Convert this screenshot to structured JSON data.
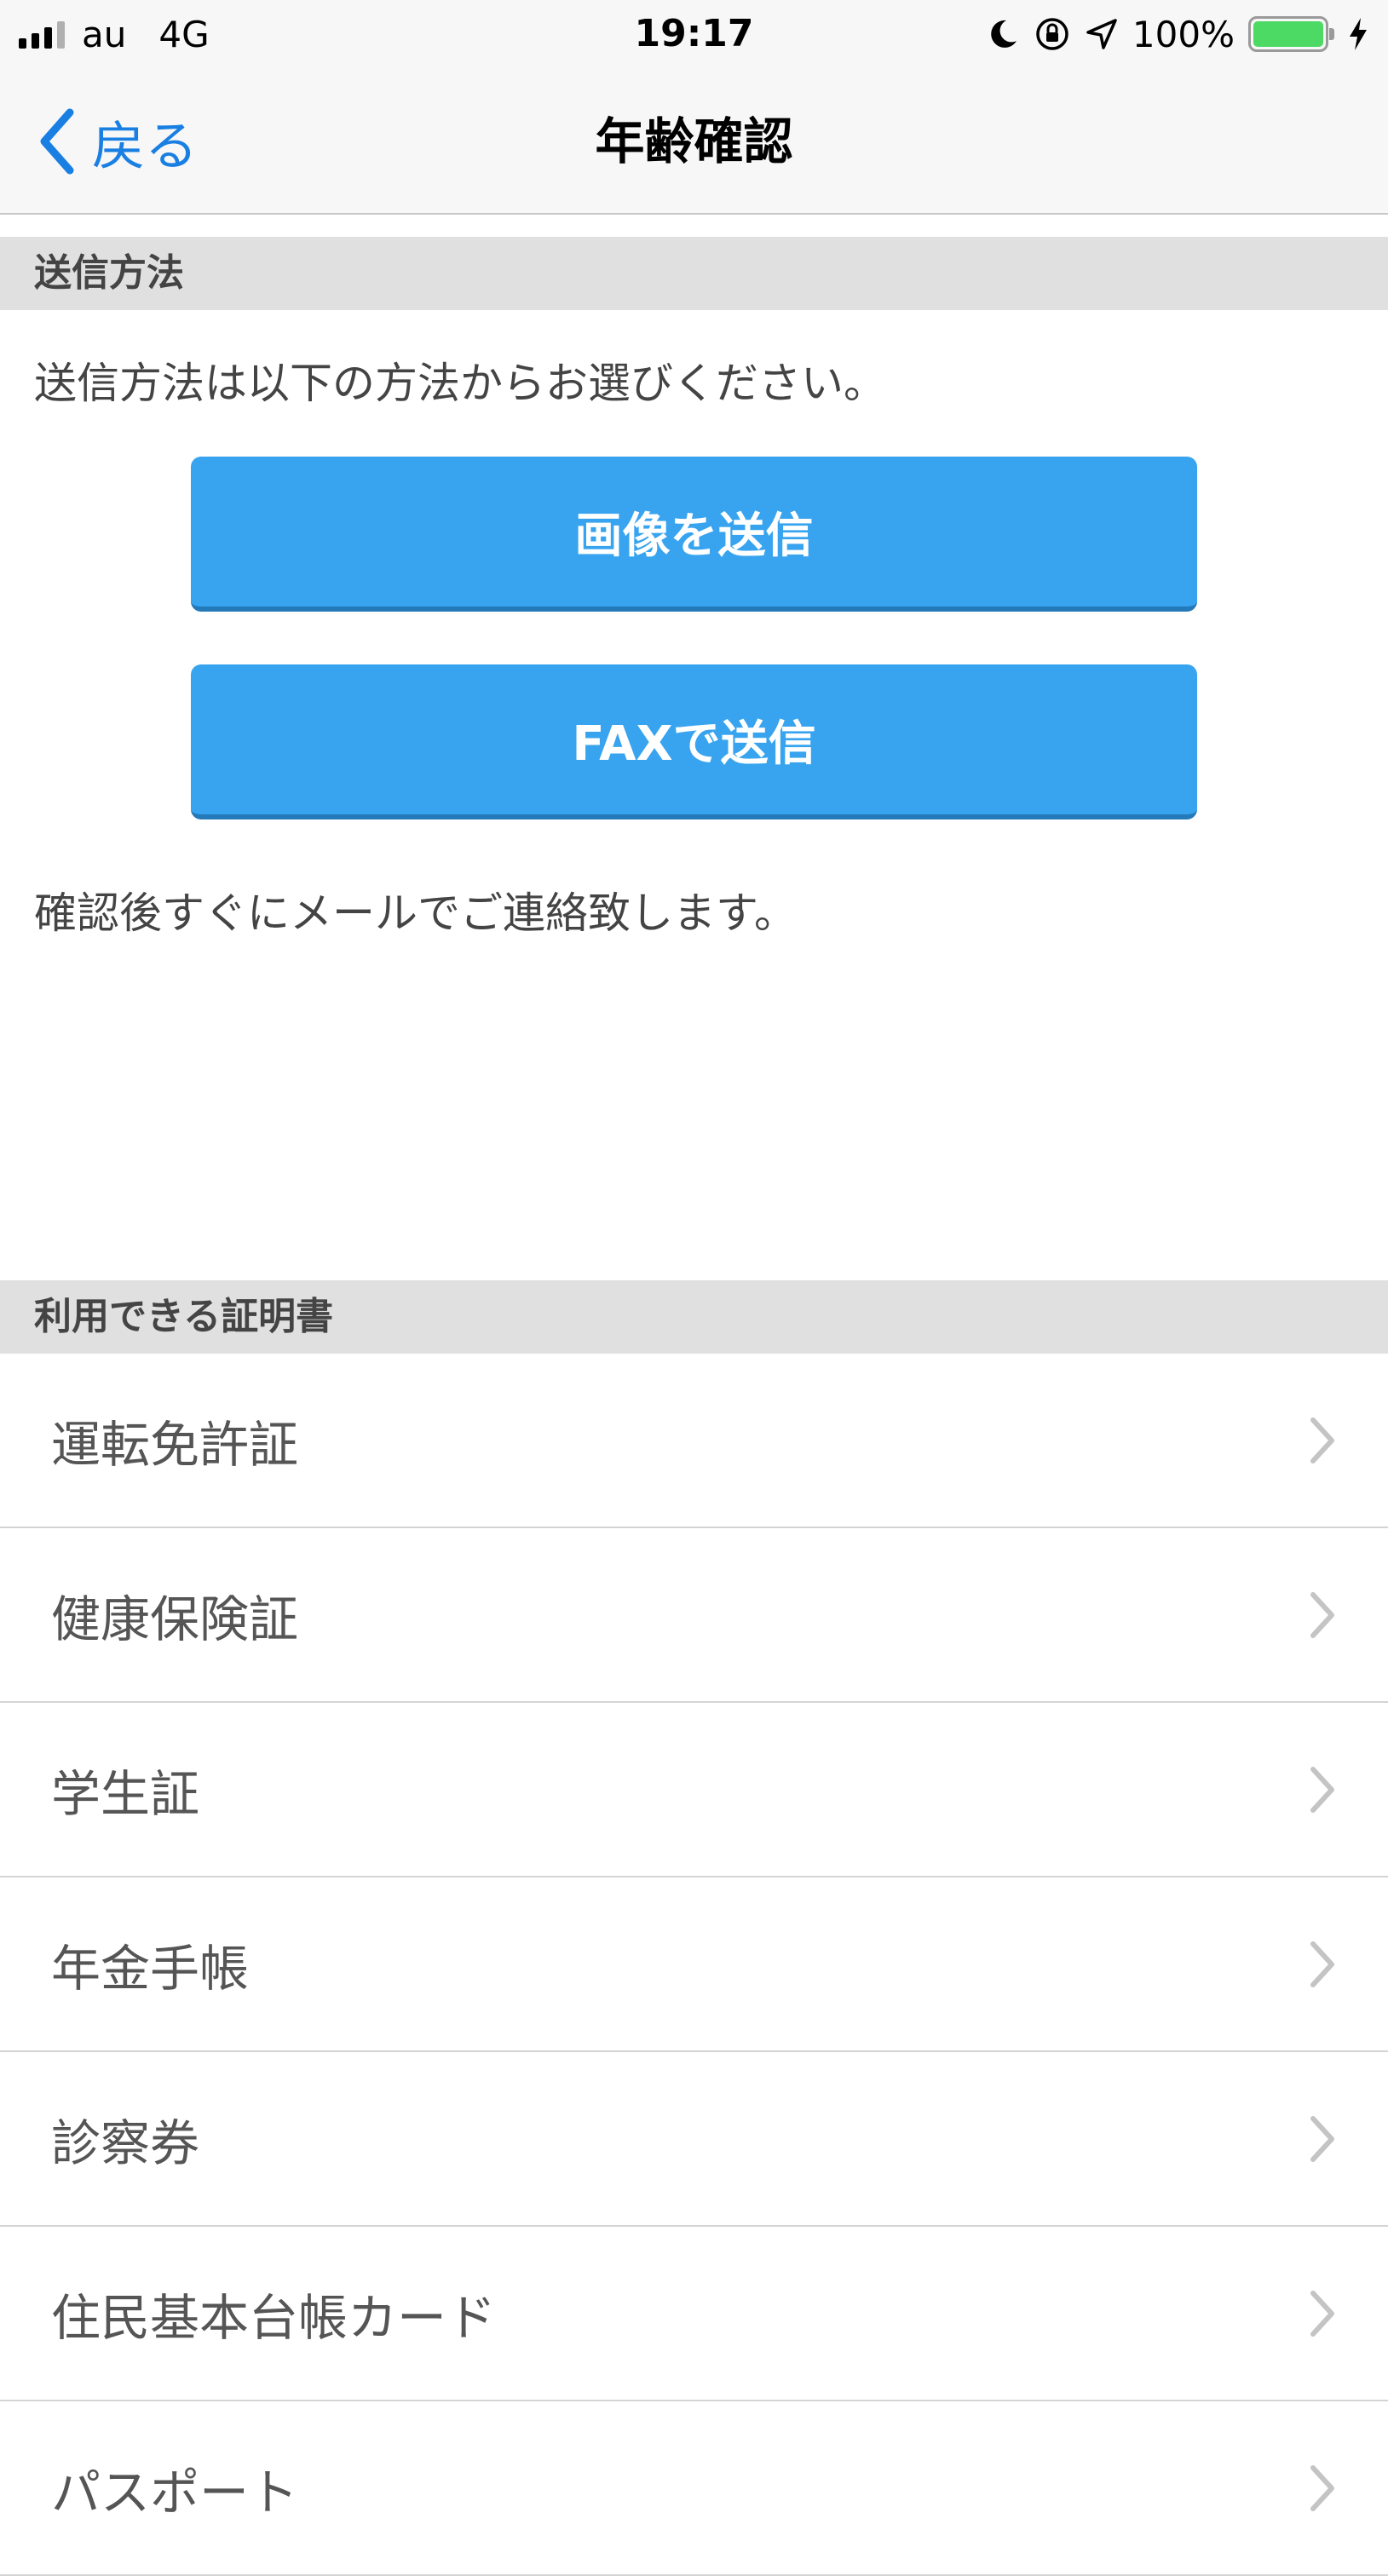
{
  "status_bar": {
    "carrier": "au",
    "network": "4G",
    "time": "19:17",
    "battery_percent": "100%",
    "battery_level": 1.0
  },
  "nav": {
    "back_label": "戻る",
    "title": "年齢確認"
  },
  "send_section": {
    "header": "送信方法",
    "instruction": "送信方法は以下の方法からお選びください。",
    "image_button": "画像を送信",
    "fax_button": "FAXで送信",
    "note": "確認後すぐにメールでご連絡致します。"
  },
  "cert_section": {
    "header": "利用できる証明書",
    "items": [
      {
        "label": "運転免許証"
      },
      {
        "label": "健康保険証"
      },
      {
        "label": "学生証"
      },
      {
        "label": "年金手帳"
      },
      {
        "label": "診察券"
      },
      {
        "label": "住民基本台帳カード"
      },
      {
        "label": "パスポート"
      }
    ]
  },
  "colors": {
    "accent": "#1a7fe3",
    "button": "#38a4ef",
    "section_header_bg": "#e0e0e0",
    "battery_fill": "#4cd964"
  }
}
